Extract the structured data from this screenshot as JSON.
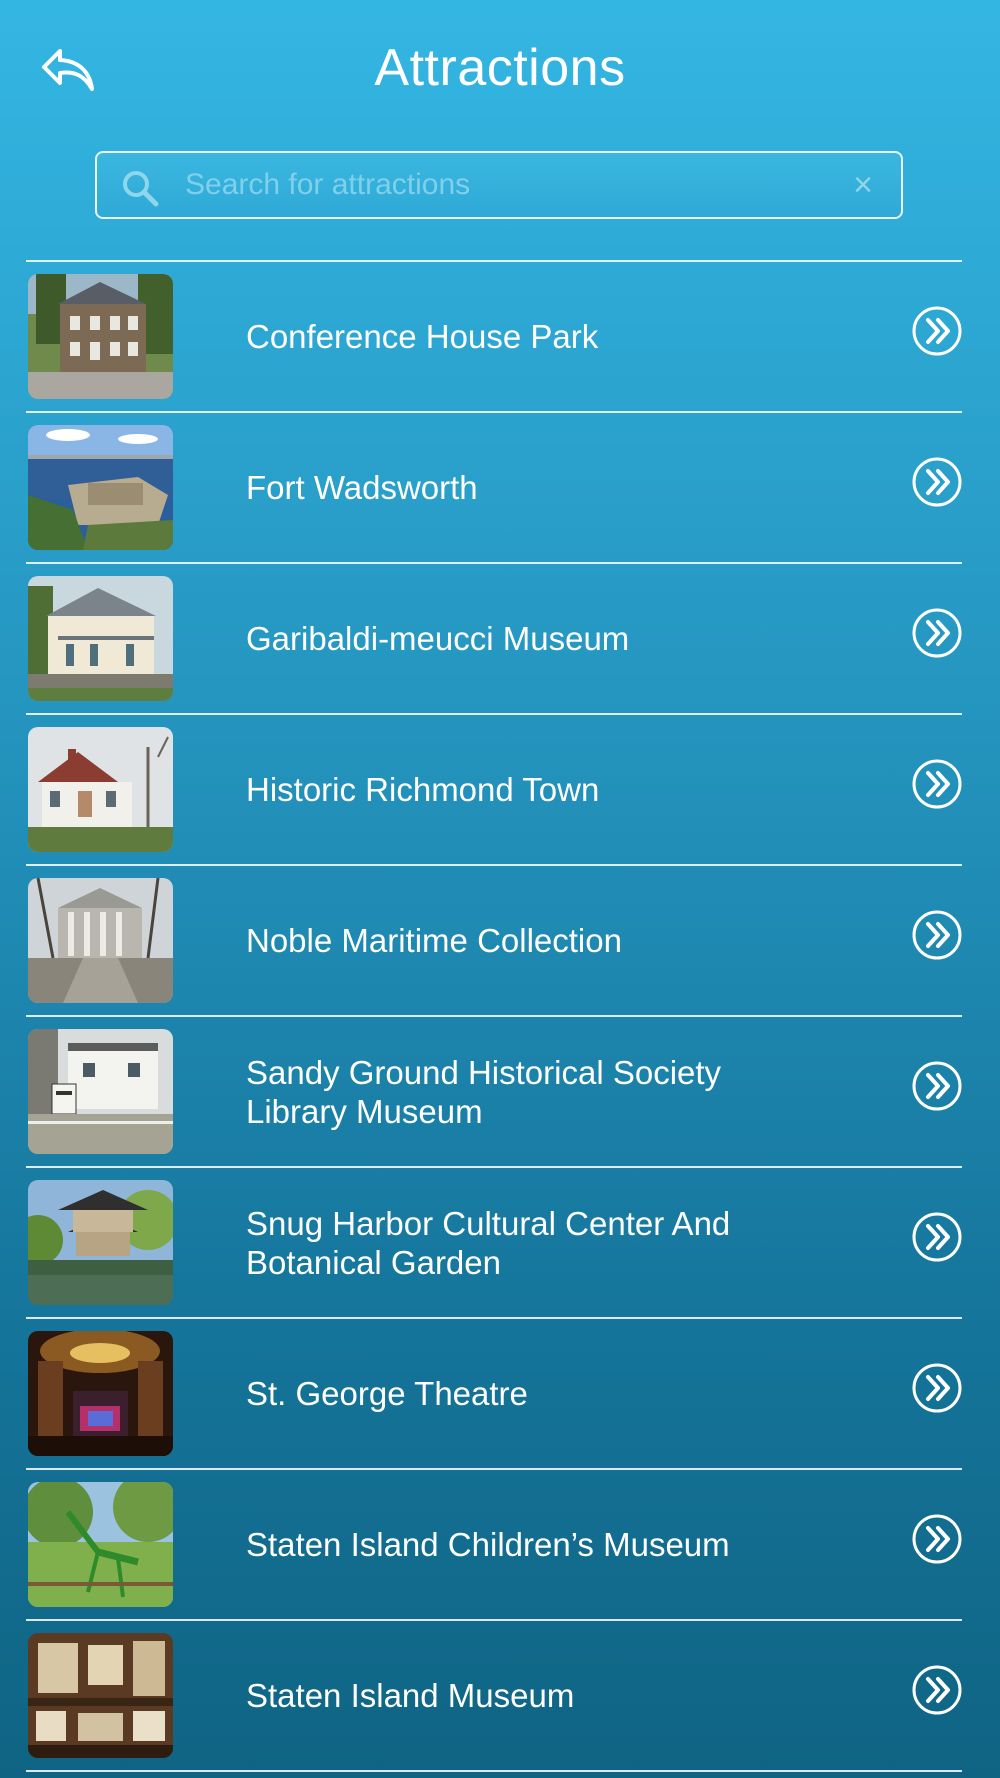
{
  "header": {
    "title": "Attractions",
    "back_icon": "reply-arrow-icon"
  },
  "search": {
    "placeholder": "Search for attractions",
    "value": "",
    "icon": "search-icon",
    "clear_icon": "clear-icon",
    "clear_glyph": "×"
  },
  "items": [
    {
      "label": "Conference House Park",
      "thumb": "stone-house"
    },
    {
      "label": "Fort Wadsworth",
      "thumb": "fort-harbor"
    },
    {
      "label": "Garibaldi-meucci Museum",
      "thumb": "white-house-porch"
    },
    {
      "label": "Historic Richmond Town",
      "thumb": "colonial-house"
    },
    {
      "label": "Noble Maritime Collection",
      "thumb": "columned-building"
    },
    {
      "label": "Sandy Ground Historical Society\nLibrary Museum",
      "thumb": "small-house-sign"
    },
    {
      "label": "Snug Harbor Cultural Center And\nBotanical Garden",
      "thumb": "pagoda-garden"
    },
    {
      "label": "St. George Theatre",
      "thumb": "theatre-interior"
    },
    {
      "label": "Staten Island Children’s Museum",
      "thumb": "mantis-sculpture"
    },
    {
      "label": "Staten Island Museum",
      "thumb": "museum-exhibit"
    }
  ],
  "colors": {
    "background_top": "#34b6e3",
    "background_bottom": "#0f6483",
    "text": "#ffffff",
    "placeholder": "#7fd0ea"
  }
}
